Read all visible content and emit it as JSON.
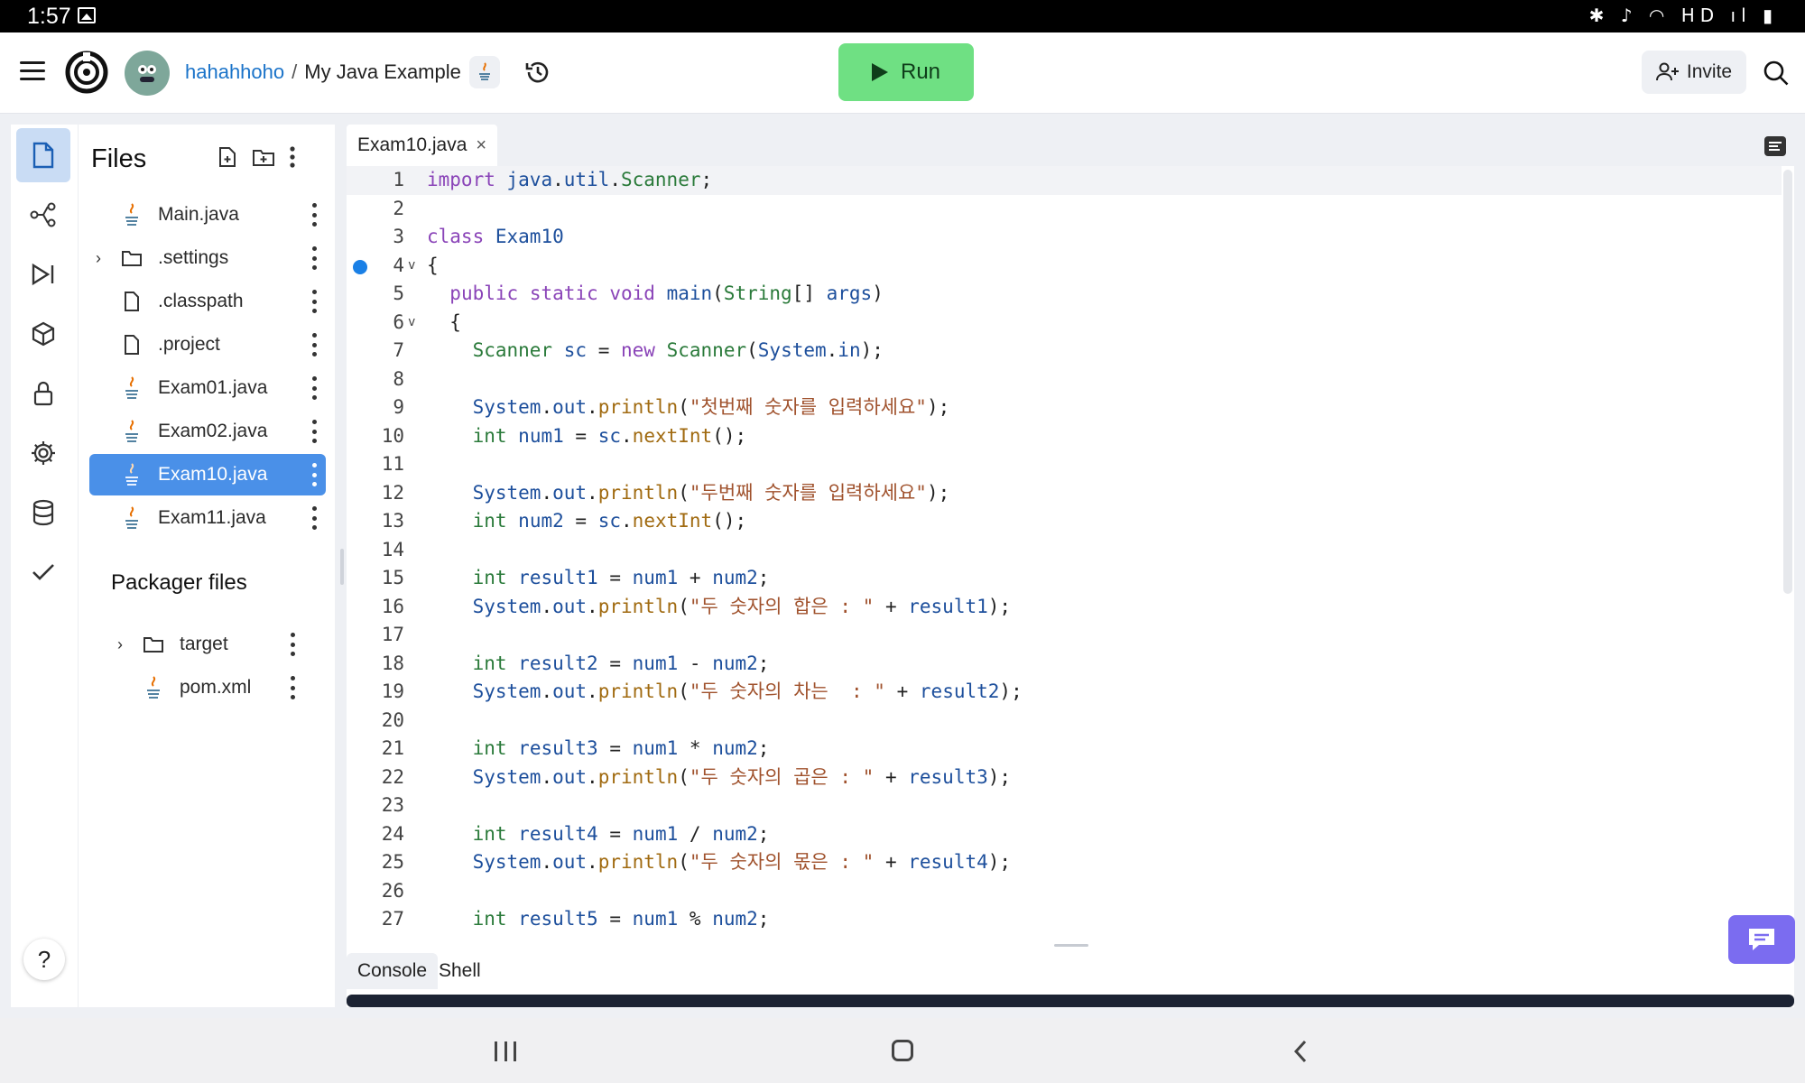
{
  "status_bar": {
    "time": "1:57",
    "right_icons": "✱ ♪ ◠ HD ıl ▮"
  },
  "header": {
    "user": "hahahhoho",
    "separator": "/",
    "project": "My Java Example",
    "run_label": "Run",
    "invite_label": "Invite",
    "colors": {
      "run_bg": "#6fe083",
      "user_link": "#1a73c9"
    }
  },
  "rail": {
    "items": [
      "files-icon",
      "git-icon",
      "debugger-icon",
      "packages-icon",
      "secrets-icon",
      "settings-icon",
      "database-icon",
      "check-icon"
    ],
    "help": "?"
  },
  "files_panel": {
    "title": "Files",
    "items": [
      {
        "name": "Main.java",
        "type": "java"
      },
      {
        "name": ".settings",
        "type": "folder"
      },
      {
        "name": ".classpath",
        "type": "file"
      },
      {
        "name": ".project",
        "type": "file"
      },
      {
        "name": "Exam01.java",
        "type": "java"
      },
      {
        "name": "Exam02.java",
        "type": "java"
      },
      {
        "name": "Exam10.java",
        "type": "java",
        "active": true
      },
      {
        "name": "Exam11.java",
        "type": "java"
      }
    ],
    "packager_title": "Packager files",
    "packager_items": [
      {
        "name": "target",
        "type": "folder"
      },
      {
        "name": "pom.xml",
        "type": "java"
      }
    ]
  },
  "editor": {
    "tab_label": "Exam10.java",
    "tab_close": "×",
    "breakpoint_line": 4,
    "lines": [
      {
        "n": "1",
        "c": "import java.util.Scanner;"
      },
      {
        "n": "2",
        "c": ""
      },
      {
        "n": "3",
        "c": "class Exam10"
      },
      {
        "n": "4",
        "c": "{"
      },
      {
        "n": "5",
        "c": "  public static void main(String[] args)"
      },
      {
        "n": "6",
        "c": "  {"
      },
      {
        "n": "7",
        "c": "    Scanner sc = new Scanner(System.in);"
      },
      {
        "n": "8",
        "c": ""
      },
      {
        "n": "9",
        "c": "    System.out.println(\"첫번째 숫자를 입력하세요\");"
      },
      {
        "n": "10",
        "c": "    int num1 = sc.nextInt();"
      },
      {
        "n": "11",
        "c": ""
      },
      {
        "n": "12",
        "c": "    System.out.println(\"두번째 숫자를 입력하세요\");"
      },
      {
        "n": "13",
        "c": "    int num2 = sc.nextInt();"
      },
      {
        "n": "14",
        "c": ""
      },
      {
        "n": "15",
        "c": "    int result1 = num1 + num2;"
      },
      {
        "n": "16",
        "c": "    System.out.println(\"두 숫자의 합은 : \" + result1);"
      },
      {
        "n": "17",
        "c": ""
      },
      {
        "n": "18",
        "c": "    int result2 = num1 - num2;"
      },
      {
        "n": "19",
        "c": "    System.out.println(\"두 숫자의 차는  : \" + result2);"
      },
      {
        "n": "20",
        "c": ""
      },
      {
        "n": "21",
        "c": "    int result3 = num1 * num2;"
      },
      {
        "n": "22",
        "c": "    System.out.println(\"두 숫자의 곱은 : \" + result3);"
      },
      {
        "n": "23",
        "c": ""
      },
      {
        "n": "24",
        "c": "    int result4 = num1 / num2;"
      },
      {
        "n": "25",
        "c": "    System.out.println(\"두 숫자의 몫은 : \" + result4);"
      },
      {
        "n": "26",
        "c": ""
      },
      {
        "n": "27",
        "c": "    int result5 = num1 % num2;"
      }
    ]
  },
  "console": {
    "tabs": [
      "Console",
      "Shell"
    ]
  }
}
